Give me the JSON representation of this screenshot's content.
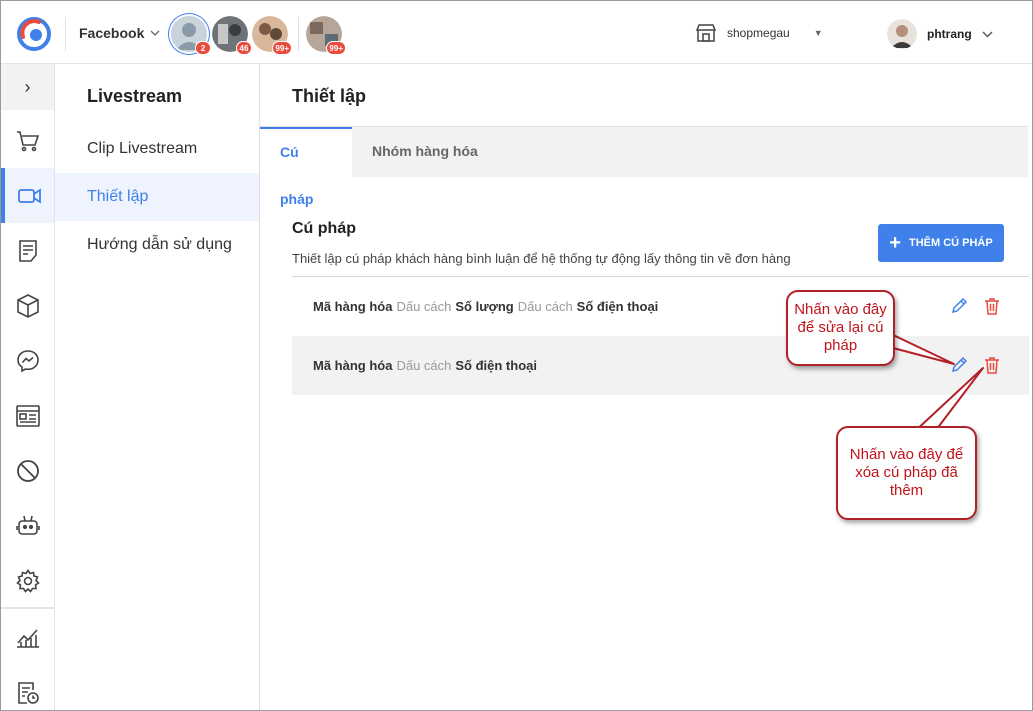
{
  "topbar": {
    "page_selector": "Facebook",
    "avatars": [
      {
        "badge": "2",
        "active": true
      },
      {
        "badge": "46",
        "active": false
      },
      {
        "badge": "99+",
        "active": false
      },
      {
        "badge": "99+",
        "active": false
      }
    ],
    "shop_name": "shopmegau",
    "user_name": "phtrang"
  },
  "rail": {
    "items": [
      "cart-icon",
      "video-icon",
      "orders-icon",
      "box-icon",
      "messenger-icon",
      "card-icon",
      "block-icon",
      "bot-icon",
      "settings-icon",
      "report-icon",
      "history-icon"
    ]
  },
  "submenu": {
    "title": "Livestream",
    "items": [
      "Clip Livestream",
      "Thiết lập",
      "Hướng dẫn sử dụng"
    ]
  },
  "main": {
    "heading": "Thiết lập",
    "tabs": [
      "Cú pháp",
      "Nhóm hàng hóa"
    ],
    "section_title": "Cú pháp",
    "section_desc": "Thiết lập cú pháp khách hàng bình luận để hệ thống tự động lấy thông tin về đơn hàng",
    "add_button": "THÊM CÚ PHÁP",
    "rows": [
      {
        "p1": "Mã hàng hóa",
        "s1": "Dấu cách",
        "p2": "Số lượng",
        "s2": "Dấu cách",
        "p3": "Số điện thoại"
      },
      {
        "p1": "Mã hàng hóa",
        "s1": "Dấu cách",
        "p2": "Số điện thoại",
        "s2": "",
        "p3": ""
      }
    ]
  },
  "callouts": {
    "edit": "Nhấn vào đây để sửa lại cú pháp",
    "delete": "Nhấn vào đây để xóa cú pháp đã thêm"
  },
  "colors": {
    "accent": "#3f80ea",
    "delete": "#e74c3c",
    "callout_border": "#b22028",
    "callout_text": "#c0141c"
  }
}
